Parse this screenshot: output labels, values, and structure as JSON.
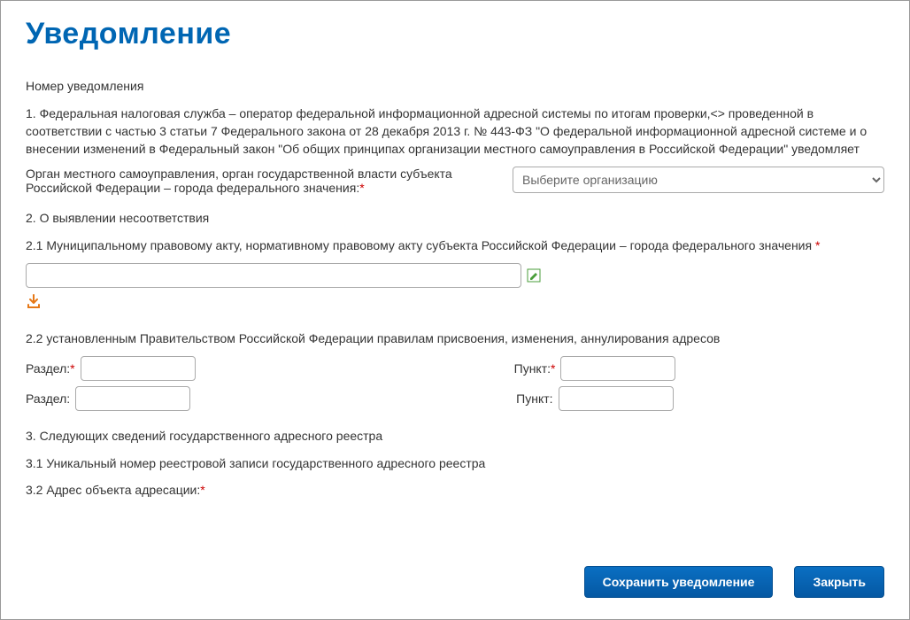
{
  "header": {
    "title": "Уведомление"
  },
  "body": {
    "number_label": "Номер уведомления",
    "p1": "1. Федеральная налоговая служба – оператор федеральной информационной адресной системы по итогам проверки,<> проведенной в соответствии с частью 3 статьи 7 Федерального закона от 28 декабря 2013 г. № 443-ФЗ \"О федеральной информационной адресной системе и о внесении изменений в Федеральный закон \"Об общих принципах организации местного самоуправления в Российской Федерации\" уведомляет",
    "org_label": "Орган местного самоуправления, орган государственной власти субъекта Российской Федерации – города федерального значения:",
    "org_placeholder": "Выберите организацию",
    "p2": "2. О выявлении несоответствия",
    "p21": "2.1 Муниципальному правовому акту, нормативному правовому акту субъекта Российской Федерации – города федерального значения ",
    "p22": "2.2 установленным Правительством Российской Федерации правилам присвоения, изменения, аннулирования адресов",
    "razdel_label": "Раздел:",
    "punkt_label": "Пункт:",
    "p3": "3. Следующих сведений государственного адресного реестра",
    "p31": "3.1 Уникальный номер реестровой записи государственного адресного реестра",
    "p32": "3.2 Адрес объекта адресации:"
  },
  "footer": {
    "save": "Сохранить уведомление",
    "close": "Закрыть"
  }
}
